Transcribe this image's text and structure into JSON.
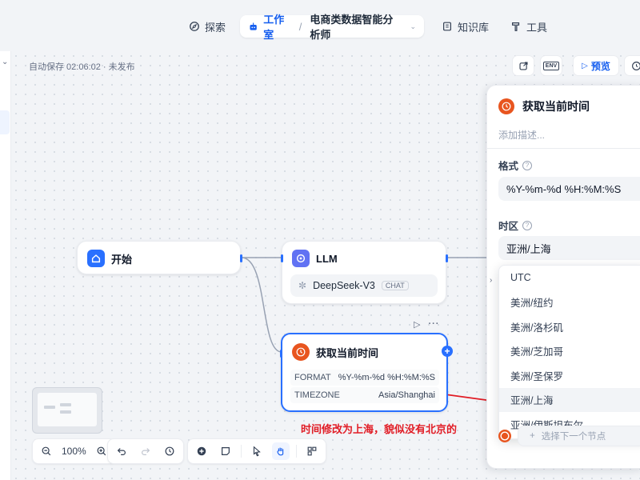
{
  "nav": {
    "explore": "探索",
    "studio": "工作室",
    "project": "电商类数据智能分析师",
    "knowledge": "知识库",
    "tools": "工具"
  },
  "toolbar": {
    "autosave": "自动保存 02:06:02 · 未发布",
    "env_label": "ENV",
    "preview": "预览"
  },
  "nodes": {
    "start": {
      "title": "开始"
    },
    "llm": {
      "title": "LLM",
      "model": "DeepSeek-V3",
      "model_tag": "CHAT"
    },
    "time": {
      "title": "获取当前时间",
      "params": [
        {
          "key": "FORMAT",
          "value": "%Y-%m-%d %H:%M:%S"
        },
        {
          "key": "TIMEZONE",
          "value": "Asia/Shanghai"
        }
      ]
    }
  },
  "annotation": "时间修改为上海，貌似没有北京的",
  "zoom": "100%",
  "panel": {
    "title": "获取当前时间",
    "description_placeholder": "添加描述...",
    "format_label": "格式",
    "format_value": "%Y-%m-%d %H:%M:%S",
    "timezone_label": "时区",
    "timezone_value": "亚洲/上海",
    "timezone_options": [
      "UTC",
      "美洲/纽约",
      "美洲/洛杉矶",
      "美洲/芝加哥",
      "美洲/圣保罗",
      "亚洲/上海",
      "亚洲/伊斯坦布尔"
    ],
    "timezone_selected_index": 5,
    "next_node": "选择下一个节点"
  },
  "colors": {
    "accent": "#155eef",
    "node_border_selected": "#2970ff",
    "time_icon": "#e8551f",
    "annotation": "#e11d26"
  }
}
